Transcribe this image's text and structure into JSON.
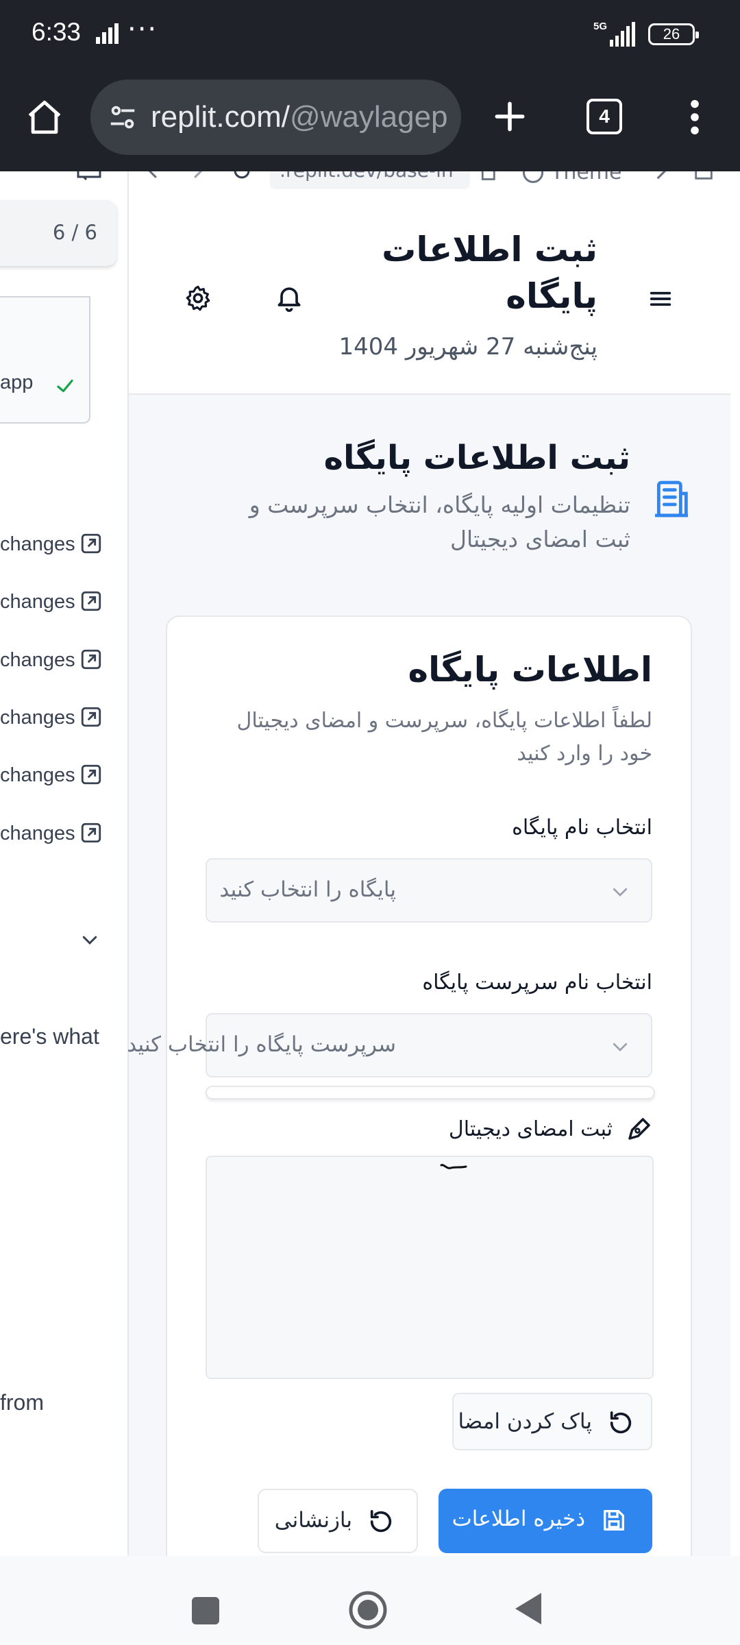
{
  "status_bar": {
    "time": "6:33",
    "more": "···",
    "network": "5G",
    "battery": "26"
  },
  "browser": {
    "url_host": "replit.com/",
    "url_path": "@waylagep",
    "tab_count": "4"
  },
  "preview_bar": {
    "url": ".replit.dev/base-in",
    "theme_label": "Theme"
  },
  "left_panel": {
    "counter": "6 / 6",
    "app_label": "app",
    "change_items": [
      "changes",
      "changes",
      "changes",
      "changes",
      "changes",
      "changes"
    ],
    "text_1": "ere's what",
    "text_2": "from"
  },
  "header": {
    "title": "ثبت اطلاعات پایگاه",
    "date": "پنج‌شنبه 27 شهریور 1404"
  },
  "page": {
    "title": "ثبت اطلاعات پایگاه",
    "subtitle": "تنظیمات اولیه پایگاه، انتخاب سرپرست و ثبت امضای دیجیتال"
  },
  "card": {
    "title": "اطلاعات پایگاه",
    "description": "لطفاً اطلاعات پایگاه، سرپرست و امضای دیجیتال خود را وارد کنید",
    "base_label": "انتخاب نام پایگاه",
    "base_placeholder": "پایگاه را انتخاب کنید",
    "supervisor_label": "انتخاب نام سرپرست پایگاه",
    "supervisor_placeholder": "سرپرست پایگاه را انتخاب کنید",
    "signature_label": "ثبت امضای دیجیتال",
    "clear_signature": "پاک کردن امضا",
    "save": "ذخیره اطلاعات",
    "reset": "بازنشانی"
  },
  "colors": {
    "primary": "#2f86ee",
    "chrome": "#1f2329",
    "page_bg": "#f5f7fa",
    "check": "#16a34a"
  }
}
